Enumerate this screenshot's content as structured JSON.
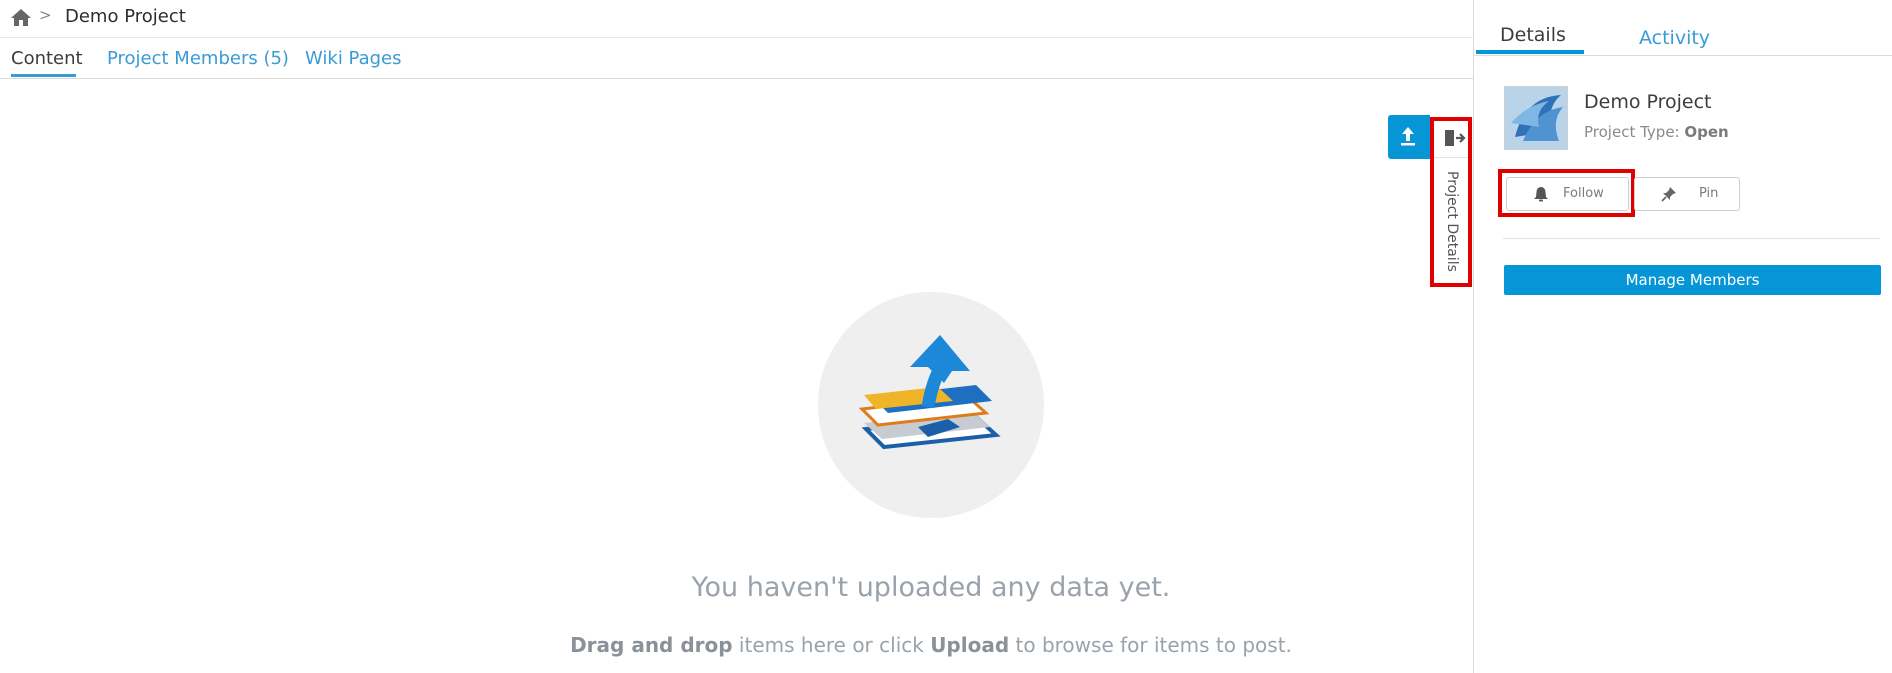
{
  "breadcrumb": {
    "separator": ">",
    "title": "Demo Project"
  },
  "tabs": [
    {
      "label": "Content",
      "active": true
    },
    {
      "label": "Project Members (5)",
      "active": false
    },
    {
      "label": "Wiki Pages",
      "active": false
    }
  ],
  "side_toggle": {
    "label": "Project Details"
  },
  "empty_state": {
    "headline": "You haven't uploaded any data yet.",
    "sub_part1": "Drag and drop",
    "sub_part2": " items here or click ",
    "sub_part3": "Upload",
    "sub_part4": " to browse for items to post."
  },
  "panel": {
    "tabs": [
      {
        "label": "Details",
        "active": true
      },
      {
        "label": "Activity",
        "active": false
      }
    ],
    "project_name": "Demo Project",
    "project_type_label": "Project Type: ",
    "project_type_value": "Open",
    "follow_label": "Follow",
    "pin_label": "Pin",
    "manage_members_label": "Manage Members"
  },
  "colors": {
    "accent": "#0696d7",
    "link": "#3a9bd5",
    "highlight": "#e00000"
  },
  "icons": [
    "home-icon",
    "upload-icon",
    "collapse-panel-icon",
    "bell-icon",
    "pin-icon"
  ]
}
